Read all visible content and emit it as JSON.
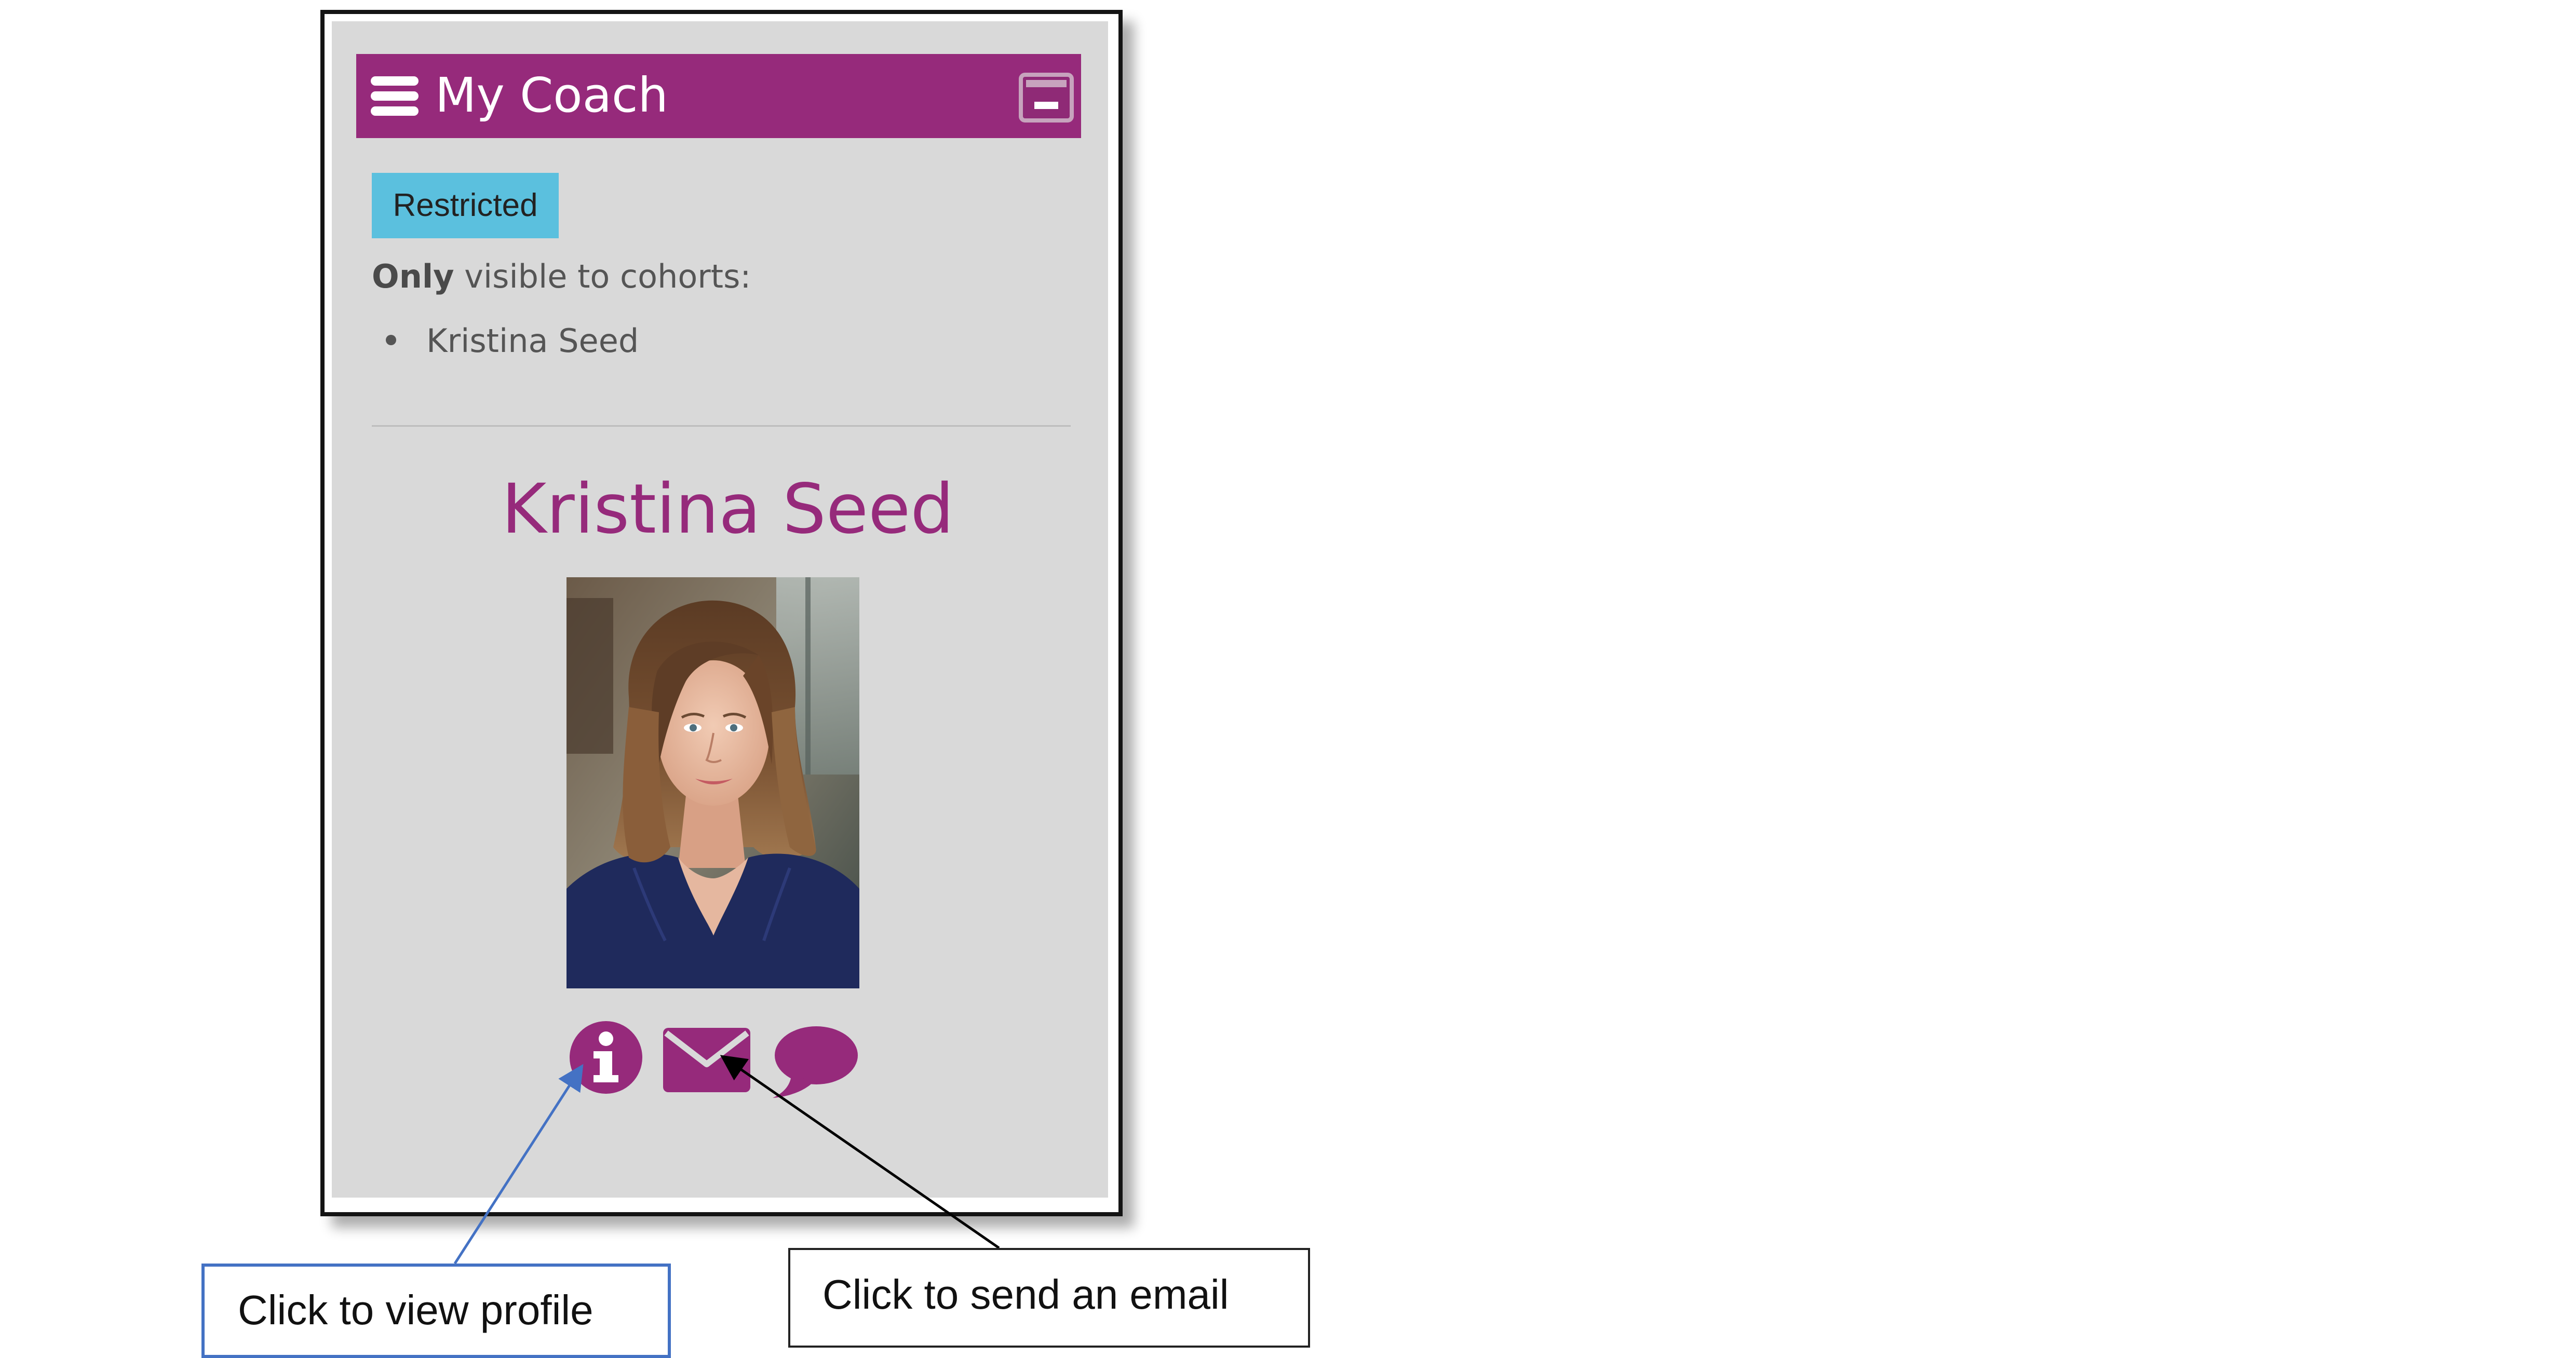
{
  "widget": {
    "title": "My Coach",
    "menu_icon": "hamburger-icon",
    "minimize_icon": "minimize-icon"
  },
  "restriction": {
    "badge": "Restricted",
    "only": "Only",
    "visible_to": " visible to cohorts:",
    "cohorts": [
      "Kristina Seed"
    ]
  },
  "coach": {
    "name": "Kristina Seed",
    "actions": [
      {
        "icon": "info-icon"
      },
      {
        "icon": "envelope-icon"
      },
      {
        "icon": "chat-bubble-icon"
      }
    ]
  },
  "callouts": {
    "profile": "Click to view profile",
    "email": "Click to send an email"
  },
  "colors": {
    "brand": "#962a7b",
    "badge": "#5bc0de",
    "panel": "#d9d9d9",
    "profile_arrow": "#4472c4",
    "email_arrow": "#000000"
  }
}
